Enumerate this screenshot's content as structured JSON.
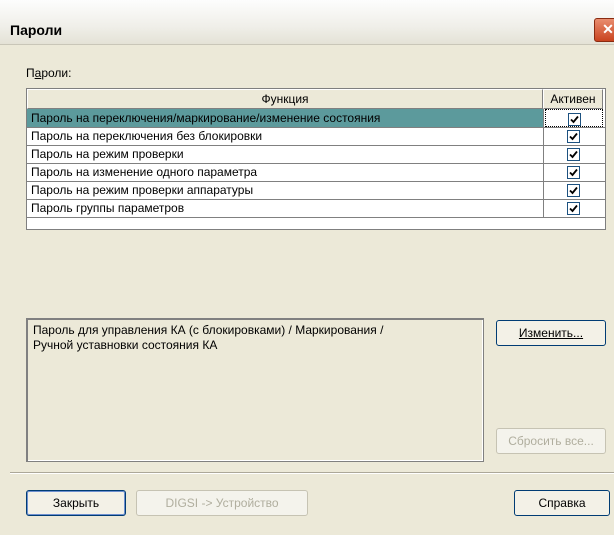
{
  "window": {
    "title": "Пароли",
    "close_glyph": "✕"
  },
  "passwords_label": {
    "text": "Пароли:",
    "mnemonic": "а"
  },
  "table": {
    "headers": {
      "function": "Функция",
      "active": "Активен"
    },
    "rows": [
      {
        "label": "Пароль на переключения/маркирование/изменение состояния",
        "active": true,
        "selected": true
      },
      {
        "label": "Пароль на переключения без блокировки",
        "active": true,
        "selected": false
      },
      {
        "label": "Пароль на режим проверки",
        "active": true,
        "selected": false
      },
      {
        "label": "Пароль на изменение одного параметра",
        "active": true,
        "selected": false
      },
      {
        "label": "Пароль на режим проверки аппаратуры",
        "active": true,
        "selected": false
      },
      {
        "label": "Пароль группы параметров",
        "active": true,
        "selected": false
      }
    ],
    "selection_color": "#5c9a9c"
  },
  "description": {
    "line1": "Пароль для управления КА (с блокировками) / Маркирования /",
    "line2": "Ручной уставновки состояния КА"
  },
  "buttons": {
    "change": "Изменить...",
    "reset_all": "Сбросить все...",
    "close": "Закрыть",
    "digsi": "DIGSI -> Устройство",
    "help": "Справка"
  }
}
